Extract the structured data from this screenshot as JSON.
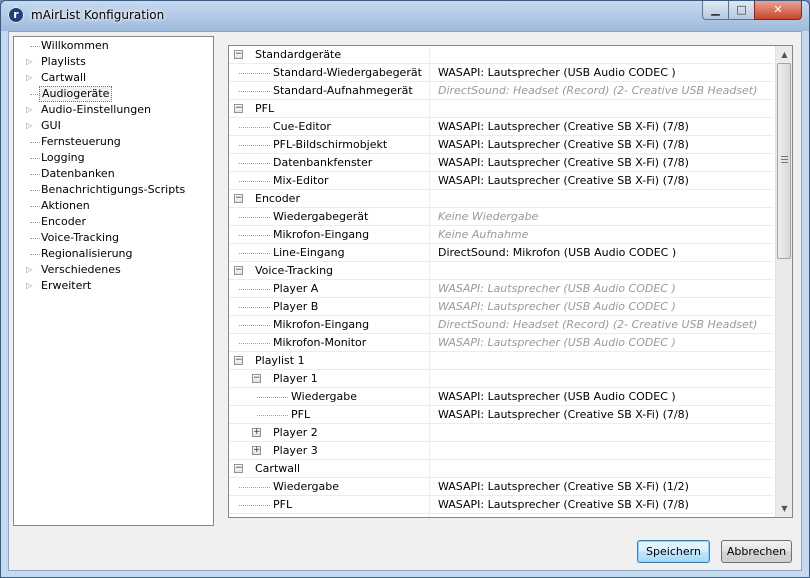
{
  "window": {
    "title": "mAirList Konfiguration",
    "icon": "mairlist-logo-icon"
  },
  "nav": {
    "items": [
      {
        "label": "Willkommen",
        "expandable": false
      },
      {
        "label": "Playlists",
        "expandable": true
      },
      {
        "label": "Cartwall",
        "expandable": true
      },
      {
        "label": "Audiogeräte",
        "expandable": false,
        "selected": true
      },
      {
        "label": "Audio-Einstellungen",
        "expandable": true
      },
      {
        "label": "GUI",
        "expandable": true
      },
      {
        "label": "Fernsteuerung",
        "expandable": false
      },
      {
        "label": "Logging",
        "expandable": false
      },
      {
        "label": "Datenbanken",
        "expandable": false
      },
      {
        "label": "Benachrichtigungs-Scripts",
        "expandable": false
      },
      {
        "label": "Aktionen",
        "expandable": false
      },
      {
        "label": "Encoder",
        "expandable": false
      },
      {
        "label": "Voice-Tracking",
        "expandable": false
      },
      {
        "label": "Regionalisierung",
        "expandable": false
      },
      {
        "label": "Verschiedenes",
        "expandable": true
      },
      {
        "label": "Erweitert",
        "expandable": true
      }
    ]
  },
  "devices": {
    "rows": [
      {
        "level": 0,
        "name": "Standardgeräte",
        "toggle": "-"
      },
      {
        "level": 1,
        "name": "Standard-Wiedergabegerät",
        "value": "WASAPI: Lautsprecher (USB Audio CODEC )"
      },
      {
        "level": 1,
        "name": "Standard-Aufnahmegerät",
        "value": "DirectSound: Headset (Record) (2- Creative USB Headset)",
        "disabled": true
      },
      {
        "level": 0,
        "name": "PFL",
        "toggle": "-"
      },
      {
        "level": 1,
        "name": "Cue-Editor",
        "value": "WASAPI: Lautsprecher (Creative SB X-Fi) (7/8)"
      },
      {
        "level": 1,
        "name": "PFL-Bildschirmobjekt",
        "value": "WASAPI: Lautsprecher (Creative SB X-Fi) (7/8)"
      },
      {
        "level": 1,
        "name": "Datenbankfenster",
        "value": "WASAPI: Lautsprecher (Creative SB X-Fi) (7/8)"
      },
      {
        "level": 1,
        "name": "Mix-Editor",
        "value": "WASAPI: Lautsprecher (Creative SB X-Fi) (7/8)"
      },
      {
        "level": 0,
        "name": "Encoder",
        "toggle": "-"
      },
      {
        "level": 1,
        "name": "Wiedergabegerät",
        "value": "Keine Wiedergabe",
        "disabled": true
      },
      {
        "level": 1,
        "name": "Mikrofon-Eingang",
        "value": "Keine Aufnahme",
        "disabled": true
      },
      {
        "level": 1,
        "name": "Line-Eingang",
        "value": "DirectSound: Mikrofon (USB Audio CODEC )"
      },
      {
        "level": 0,
        "name": "Voice-Tracking",
        "toggle": "-"
      },
      {
        "level": 1,
        "name": "Player A",
        "value": "WASAPI: Lautsprecher (USB Audio CODEC )",
        "disabled": true
      },
      {
        "level": 1,
        "name": "Player B",
        "value": "WASAPI: Lautsprecher (USB Audio CODEC )",
        "disabled": true
      },
      {
        "level": 1,
        "name": "Mikrofon-Eingang",
        "value": "DirectSound: Headset (Record) (2- Creative USB Headset)",
        "disabled": true
      },
      {
        "level": 1,
        "name": "Mikrofon-Monitor",
        "value": "WASAPI: Lautsprecher (USB Audio CODEC )",
        "disabled": true
      },
      {
        "level": 0,
        "name": "Playlist 1",
        "toggle": "-"
      },
      {
        "level": 1,
        "name": "Player 1",
        "toggle": "-"
      },
      {
        "level": 2,
        "name": "Wiedergabe",
        "value": "WASAPI: Lautsprecher (USB Audio CODEC )"
      },
      {
        "level": 2,
        "name": "PFL",
        "value": "WASAPI: Lautsprecher (Creative SB X-Fi) (7/8)"
      },
      {
        "level": 1,
        "name": "Player 2",
        "toggle": "+"
      },
      {
        "level": 1,
        "name": "Player 3",
        "toggle": "+"
      },
      {
        "level": 0,
        "name": "Cartwall",
        "toggle": "-"
      },
      {
        "level": 1,
        "name": "Wiedergabe",
        "value": "WASAPI: Lautsprecher (Creative SB X-Fi) (1/2)"
      },
      {
        "level": 1,
        "name": "PFL",
        "value": "WASAPI: Lautsprecher (Creative SB X-Fi) (7/8)"
      }
    ]
  },
  "buttons": {
    "save": "Speichern",
    "cancel": "Abbrechen"
  },
  "colors": {
    "disabled_text": "#9a9a9a",
    "selection_border": "#777777",
    "primary_button": "#3c7fb1"
  }
}
